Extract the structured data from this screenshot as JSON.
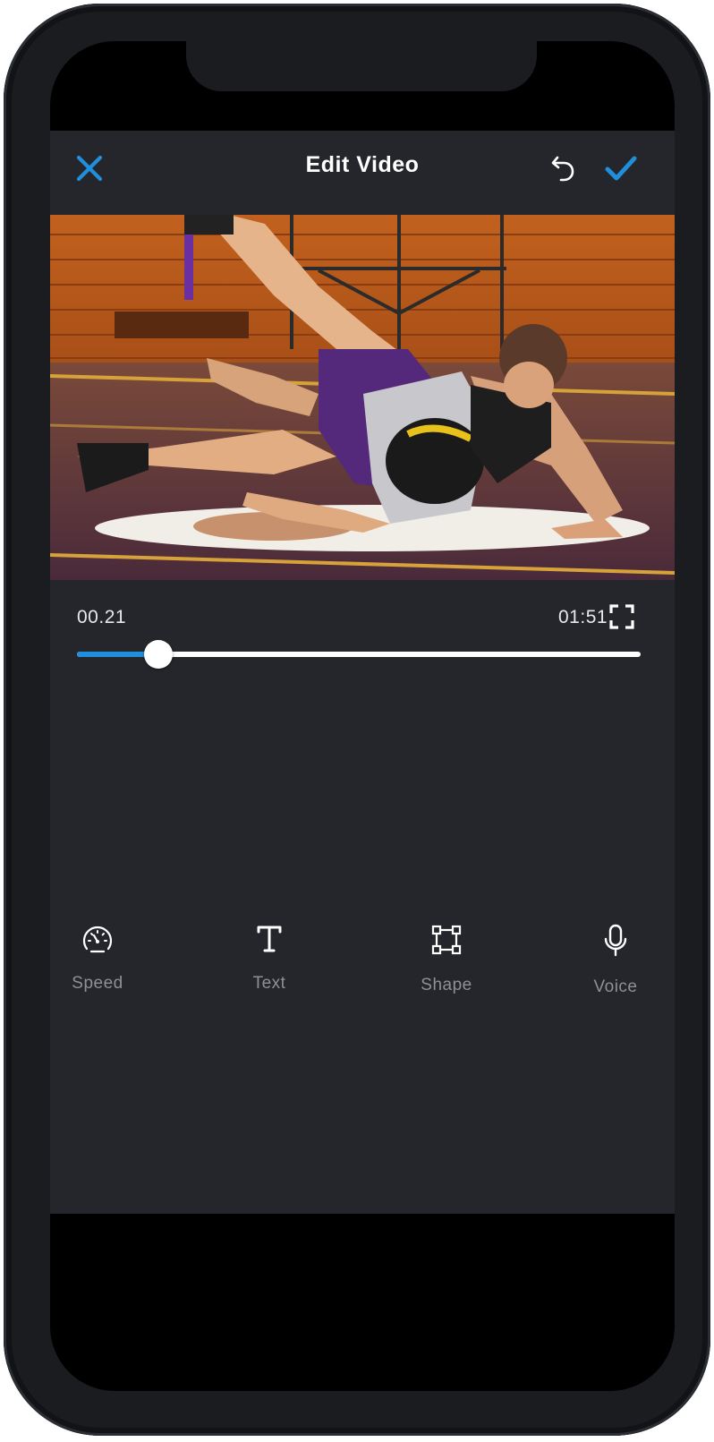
{
  "header": {
    "title": "Edit Video",
    "close_icon": "close-icon",
    "undo_icon": "undo-icon",
    "confirm_icon": "checkmark-icon"
  },
  "player": {
    "current_time": "00.21",
    "total_time": "01:51",
    "progress_fraction": 0.145,
    "fullscreen_icon": "fullscreen-icon"
  },
  "tools": [
    {
      "label": "Speed",
      "icon": "speedometer-icon"
    },
    {
      "label": "Text",
      "icon": "text-icon"
    },
    {
      "label": "Shape",
      "icon": "shape-icon"
    },
    {
      "label": "Voice",
      "icon": "microphone-icon"
    }
  ],
  "colors": {
    "accent": "#1f8fdc",
    "background": "#25262b",
    "title": "#ffffff",
    "tool_label": "#8e9096"
  }
}
